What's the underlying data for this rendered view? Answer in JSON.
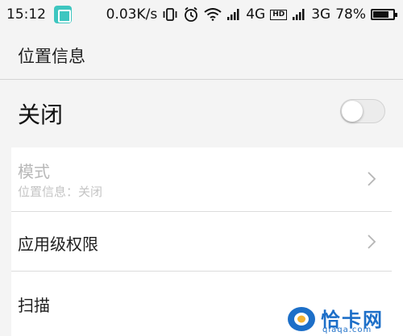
{
  "status_bar": {
    "time": "15:12",
    "net_speed": "0.03K/s",
    "network_1": "4G",
    "hd_badge": "HD",
    "network_2": "3G",
    "battery_percent": "78%",
    "battery_level": 0.78,
    "app_icon": "scan-app-icon",
    "icons": [
      "vibrate-icon",
      "alarm-icon",
      "wifi-icon",
      "signal-icon",
      "signal-icon",
      "battery-icon"
    ]
  },
  "header": {
    "title": "位置信息"
  },
  "master_switch": {
    "label": "关闭",
    "enabled": false
  },
  "settings": {
    "mode": {
      "title": "模式",
      "subtitle": "位置信息：关闭",
      "disabled": true
    },
    "app_permissions": {
      "title": "应用级权限"
    },
    "scanning": {
      "title": "扫描"
    }
  },
  "watermark": {
    "brand": "恰卡网",
    "domain": "qiaqa.com"
  },
  "colors": {
    "background": "#f4f4f4",
    "card": "#ffffff",
    "disabled_text": "#b8b8b8",
    "accent_watermark": "#1d6fc8",
    "app_icon": "#3ec6c0"
  }
}
